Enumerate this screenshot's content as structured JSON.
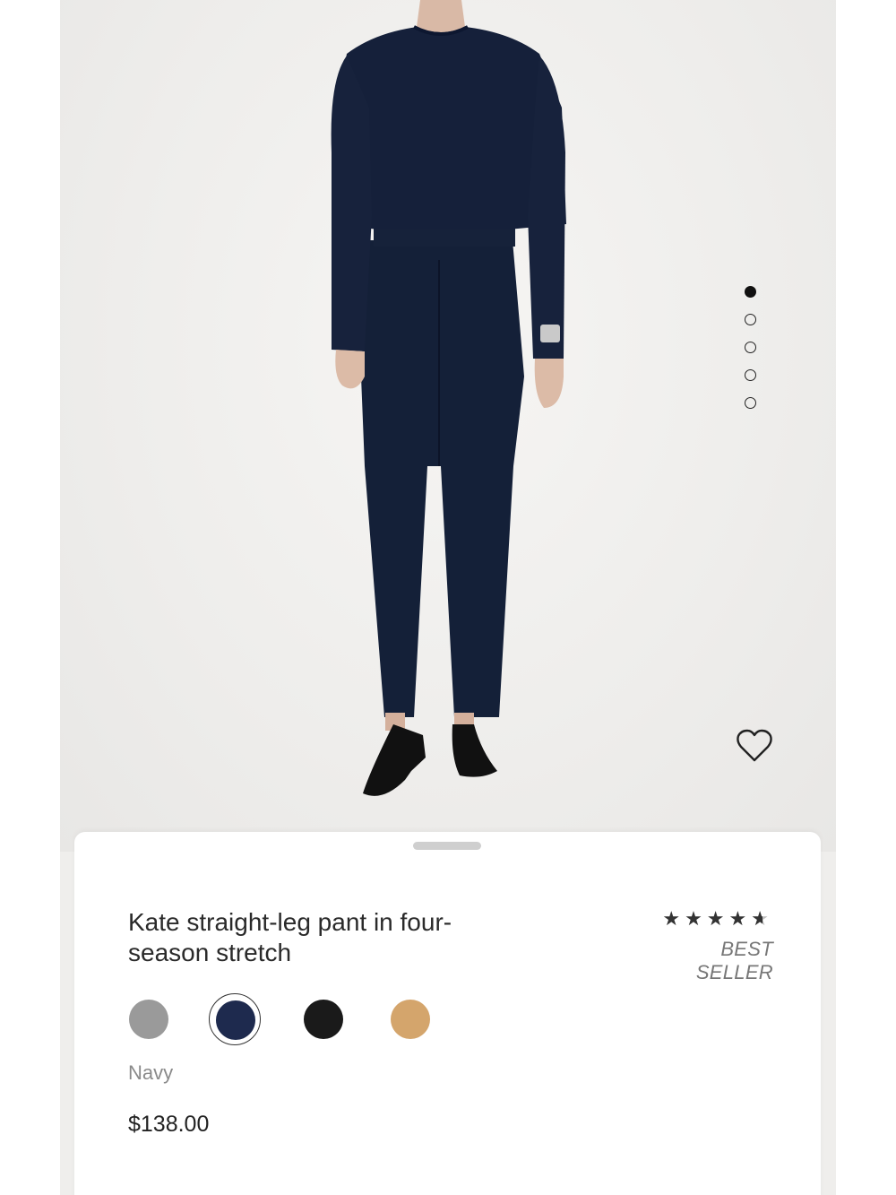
{
  "product": {
    "name": "Kate straight-leg pant in four-season stretch",
    "rating_stars": 4.5,
    "badge": "BEST SELLER",
    "selected_color": "Navy",
    "price": "$138.00"
  },
  "gallery": {
    "image_count": 5,
    "active_index": 0
  },
  "swatches": [
    {
      "color": "#9a9a9a",
      "selected": false
    },
    {
      "color": "#1e2a4e",
      "selected": true
    },
    {
      "color": "#1a1a1a",
      "selected": false
    },
    {
      "color": "#d4a56c",
      "selected": false
    }
  ],
  "icons": {
    "favorite": "heart-outline-icon",
    "rating": "star-icon"
  }
}
